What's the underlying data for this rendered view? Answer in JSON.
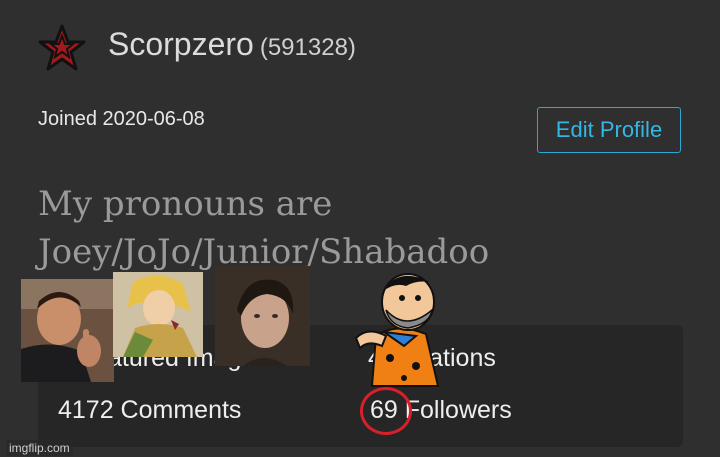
{
  "profile": {
    "username": "Scorpzero",
    "user_id": "(591328)",
    "joined": "Joined 2020-06-08",
    "edit_button": "Edit Profile",
    "bio_line1": "My pronouns are",
    "bio_line2": "Joey/JoJo/Junior/Shabadoo"
  },
  "stats": {
    "featured": "0 Featured Images",
    "creations": "4 Creations",
    "comments": "4172 Comments",
    "followers": "69 Followers"
  },
  "watermark": "imgflip.com",
  "colors": {
    "background": "#2f2f2f",
    "panel": "#262626",
    "accent": "#34b6e6",
    "annotation": "#d9202a",
    "star": "#a2181e"
  },
  "icons": {
    "avatar": "star-icon"
  }
}
